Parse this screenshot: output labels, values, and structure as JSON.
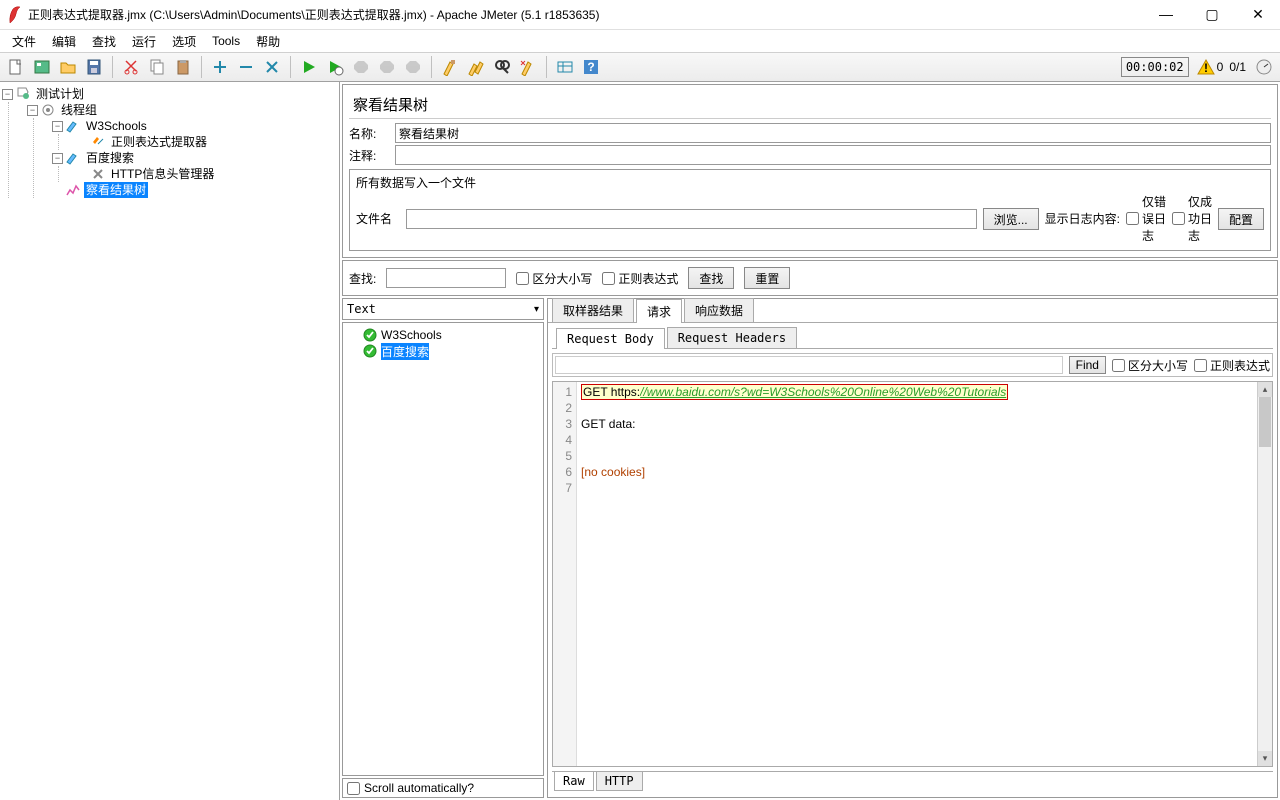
{
  "window": {
    "title": "正则表达式提取器.jmx (C:\\Users\\Admin\\Documents\\正则表达式提取器.jmx) - Apache JMeter (5.1 r1853635)"
  },
  "menu": [
    "文件",
    "编辑",
    "查找",
    "运行",
    "选项",
    "Tools",
    "帮助"
  ],
  "status": {
    "timer": "00:00:02",
    "count": "0/1"
  },
  "tree": {
    "root": "测试计划",
    "thread_group": "线程组",
    "items": [
      {
        "label": "W3Schools",
        "children": [
          "正则表达式提取器"
        ]
      },
      {
        "label": "百度搜索",
        "children": [
          "HTTP信息头管理器"
        ]
      },
      {
        "label": "察看结果树",
        "selected": true
      }
    ]
  },
  "panel": {
    "heading": "察看结果树",
    "name_label": "名称:",
    "name_value": "察看结果树",
    "comment_label": "注释:",
    "comment_value": "",
    "file_group": "所有数据写入一个文件",
    "filename_label": "文件名",
    "browse_btn": "浏览...",
    "log_label": "显示日志内容:",
    "only_error": "仅错误日志",
    "only_success": "仅成功日志",
    "config_btn": "配置"
  },
  "search": {
    "label": "查找:",
    "case": "区分大小写",
    "regex": "正则表达式",
    "find_btn": "查找",
    "reset_btn": "重置"
  },
  "results": {
    "renderer": "Text",
    "scroll_auto": "Scroll automatically?",
    "samples": [
      {
        "label": "W3Schools",
        "selected": false
      },
      {
        "label": "百度搜索",
        "selected": true
      }
    ]
  },
  "detail_tabs": {
    "tab1": "取样器结果",
    "tab2": "请求",
    "tab3": "响应数据"
  },
  "sub_tabs": {
    "tab1": "Request Body",
    "tab2": "Request Headers"
  },
  "find": {
    "btn": "Find",
    "case": "区分大小写",
    "regex": "正则表达式"
  },
  "request": {
    "line1_prefix": "GET https:",
    "line1_url": "//www.baidu.com/s?wd=W3Schools%20Online%20Web%20Tutorials",
    "line3": "GET data:",
    "line6": "[no cookies]"
  },
  "bottom_tabs": {
    "raw": "Raw",
    "http": "HTTP"
  }
}
